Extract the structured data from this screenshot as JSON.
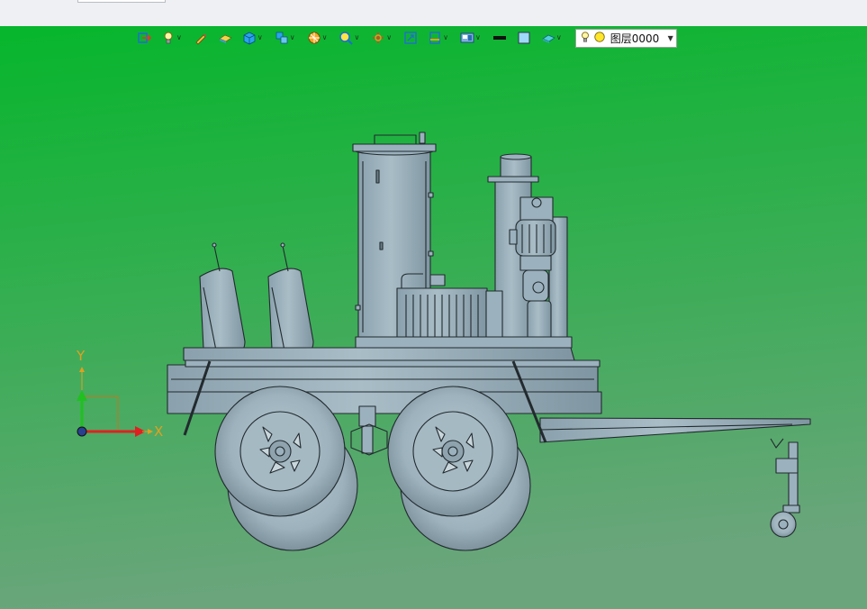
{
  "toolbar": {
    "buttons": [
      {
        "icon": "exit-view-icon",
        "dropdown": false
      },
      {
        "icon": "light-bulb-icon",
        "dropdown": true
      },
      {
        "icon": "sketch-pen-icon",
        "dropdown": false
      },
      {
        "icon": "shaded-solid-icon",
        "dropdown": false
      },
      {
        "icon": "solid-cube-icon",
        "dropdown": true
      },
      {
        "icon": "multi-cube-icon",
        "dropdown": true
      },
      {
        "icon": "render-sphere-icon",
        "dropdown": true
      },
      {
        "icon": "zoom-view-icon",
        "dropdown": true
      },
      {
        "icon": "pan-rotate-icon",
        "dropdown": true
      },
      {
        "icon": "fit-view-icon",
        "dropdown": false
      },
      {
        "icon": "section-view-icon",
        "dropdown": true
      },
      {
        "icon": "display-mode-icon",
        "dropdown": true
      },
      {
        "icon": "line-color-icon",
        "dropdown": false
      },
      {
        "icon": "face-color-icon",
        "dropdown": false
      },
      {
        "icon": "material-icon",
        "dropdown": true
      }
    ],
    "layer": {
      "name": "图层0000",
      "icons": [
        "light-bulb-icon",
        "layer-on-icon"
      ]
    }
  },
  "triad": {
    "x_label": "X",
    "y_label": "Y",
    "x_color": "#e02020",
    "y_color": "#20c020",
    "origin_color": "#2a3f8f",
    "label_color": "#e0a020"
  },
  "scene": {
    "background_top": "#06b62c",
    "background_bottom": "#6ba57c",
    "model_color": "#9bb1bd",
    "edge_color": "#222a2e",
    "model_name": "trailer-mounted-oil-purifier"
  }
}
